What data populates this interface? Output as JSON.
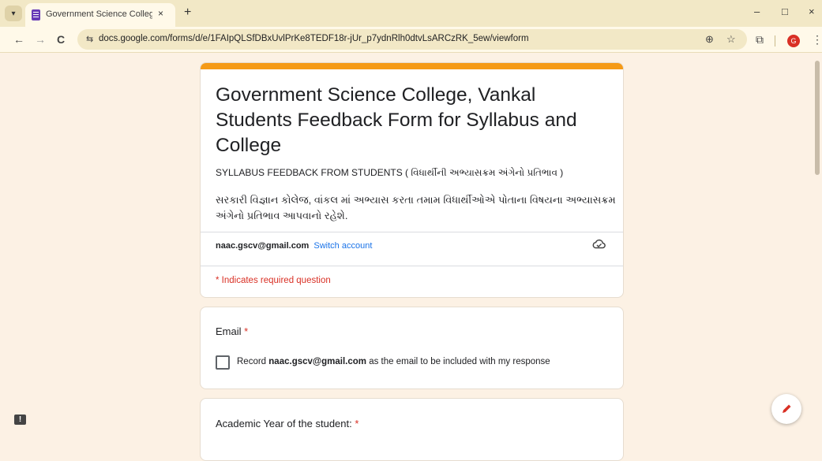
{
  "browser": {
    "tab_title": "Government Science College, V",
    "new_tab_label": "+",
    "tab_close_label": "×",
    "url": "docs.google.com/forms/d/e/1FAIpQLSfDBxUvlPrKe8TEDF18r-jUr_p7ydnRlh0dtvLsARCzRK_5ew/viewform",
    "back_icon": "←",
    "forward_icon": "→",
    "reload_icon": "C",
    "site_info_icon": "⇆",
    "zoom_icon": "⊕",
    "bookmark_icon": "☆",
    "extensions_icon": "⧉",
    "profile_initial": "G",
    "menu_icon": "⋮",
    "window_buttons": [
      "–",
      "□",
      "×"
    ]
  },
  "form": {
    "accent_color": "#f59a17",
    "title": "Government Science College, Vankal Students Feedback Form for Syllabus and College",
    "subtitle": "SYLLABUS FEEDBACK FROM STUDENTS ( વિધાર્થીની અભ્યાસક્રમ અંગેનો પ્રતિભાવ )",
    "description": "સરકારી વિજ્ઞાન કોલેજ, વાંકલ માં અભ્યાસ કરતા તમામ વિધાર્થીઓએ પોતાના વિષયના અભ્યાસક્રમ અંગેનો પ્રતિભાવ આપવાનો રહેશે.",
    "account_email": "naac.gscv@gmail.com",
    "switch_account_label": "Switch account",
    "required_note": "* Indicates required question",
    "questions": [
      {
        "title": "Email",
        "required_mark": "*",
        "checkbox_label_prefix": "Record",
        "checkbox_label_email": "naac.gscv@gmail.com",
        "checkbox_label_suffix": "as the email to be included with my response"
      },
      {
        "title": "Academic Year of the student:",
        "required_mark": "*"
      }
    ]
  },
  "fab": {
    "edit_icon": "edit-icon"
  },
  "feedback_icon_label": "!"
}
